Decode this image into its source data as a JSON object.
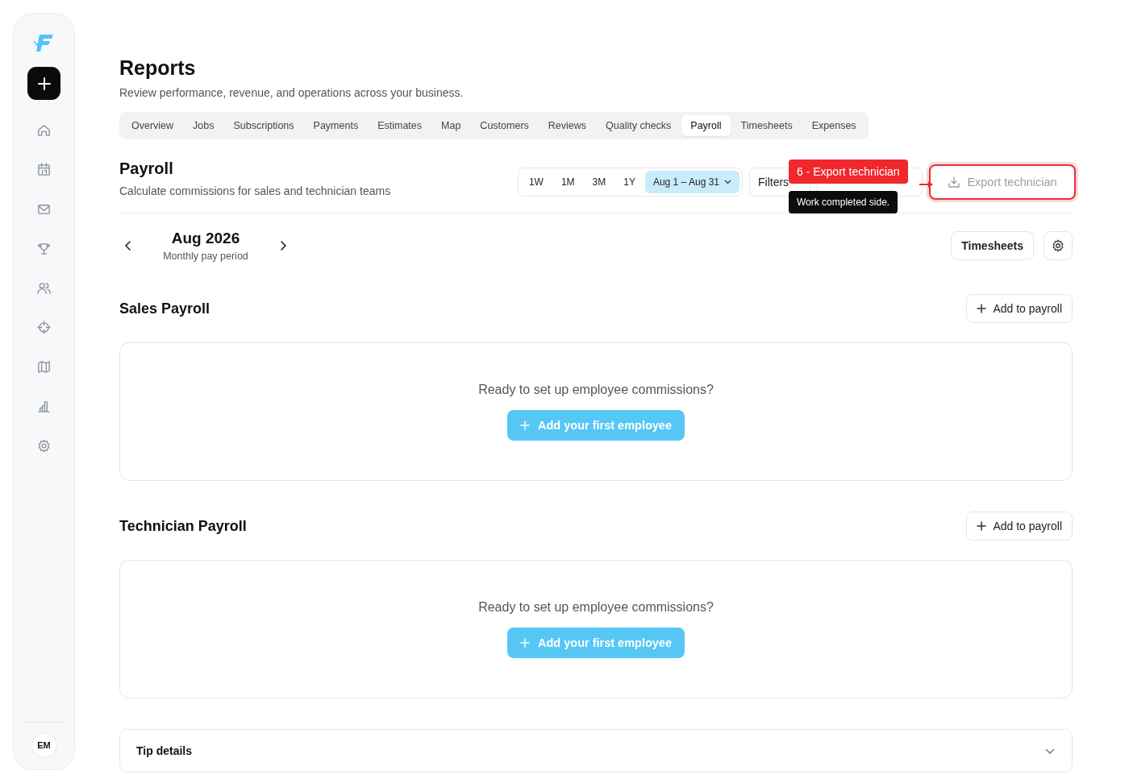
{
  "sidebar": {
    "avatar": "EM"
  },
  "header": {
    "title": "Reports",
    "subtitle": "Review performance, revenue, and operations across your business."
  },
  "tabs": [
    {
      "label": "Overview",
      "selected": false
    },
    {
      "label": "Jobs",
      "selected": false
    },
    {
      "label": "Subscriptions",
      "selected": false
    },
    {
      "label": "Payments",
      "selected": false
    },
    {
      "label": "Estimates",
      "selected": false
    },
    {
      "label": "Map",
      "selected": false
    },
    {
      "label": "Customers",
      "selected": false
    },
    {
      "label": "Reviews",
      "selected": false
    },
    {
      "label": "Quality checks",
      "selected": false
    },
    {
      "label": "Payroll",
      "selected": true
    },
    {
      "label": "Timesheets",
      "selected": false
    },
    {
      "label": "Expenses",
      "selected": false
    }
  ],
  "section": {
    "title": "Payroll",
    "subtitle": "Calculate commissions for sales and technician teams"
  },
  "ranges": [
    {
      "label": "1W",
      "selected": false
    },
    {
      "label": "1M",
      "selected": false
    },
    {
      "label": "3M",
      "selected": false
    },
    {
      "label": "1Y",
      "selected": false
    },
    {
      "label": "Aug 1 – Aug 31",
      "selected": true
    }
  ],
  "toolbar": {
    "filters": "Filters",
    "export_technician": "Export technician"
  },
  "callout": {
    "label": "6 - Export technician",
    "tooltip": "Work completed side."
  },
  "period": {
    "month": "Aug 2026",
    "caption": "Monthly pay period"
  },
  "timesheets_button": "Timesheets",
  "payrolls": [
    {
      "title": "Sales Payroll",
      "add_button": "Add to payroll",
      "empty_message": "Ready to set up employee commissions?",
      "cta": "Add your first employee"
    },
    {
      "title": "Technician Payroll",
      "add_button": "Add to payroll",
      "empty_message": "Ready to set up employee commissions?",
      "cta": "Add your first employee"
    }
  ],
  "tip_details": {
    "title": "Tip details",
    "expanded": false
  }
}
